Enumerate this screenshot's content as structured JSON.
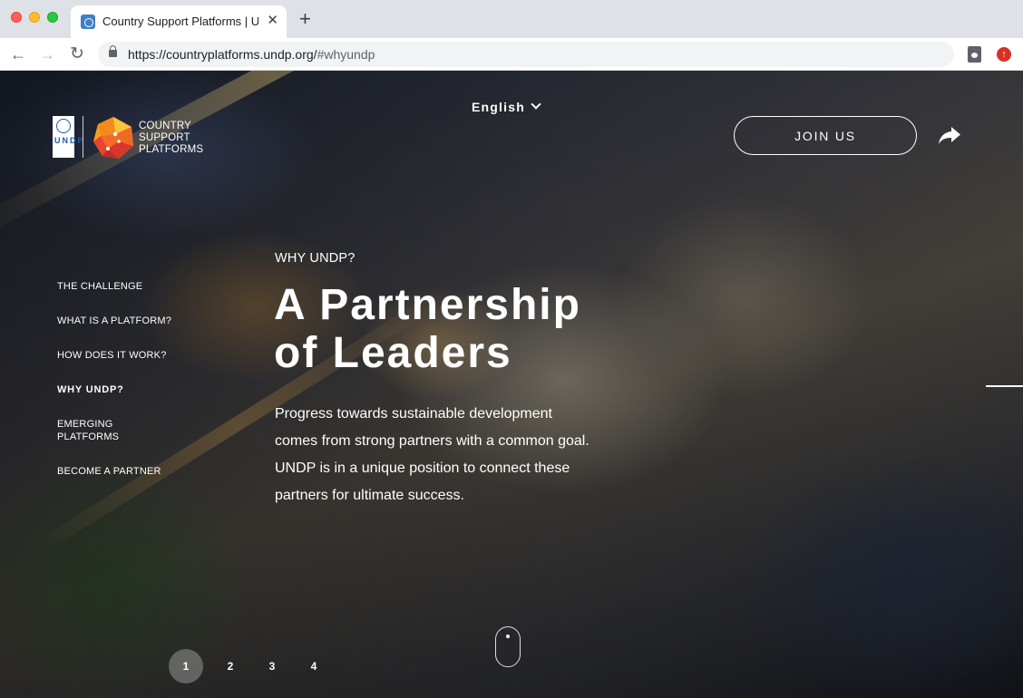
{
  "browser": {
    "tab_title": "Country Support Platforms | UNDP",
    "close_glyph": "✕",
    "new_tab_glyph": "+",
    "back_glyph": "←",
    "forward_glyph": "→",
    "reload_glyph": "↻",
    "url_main": "https://countryplatforms.undp.org/",
    "url_hash": "#whyundp",
    "update_glyph": "↑"
  },
  "logo": {
    "undp_letters": "UNDP",
    "line1": "COUNTRY",
    "line2": "SUPPORT",
    "line3": "PLATFORMS"
  },
  "header": {
    "language": "English",
    "join_label": "JOIN US"
  },
  "side_nav": {
    "items": [
      {
        "label": "THE CHALLENGE"
      },
      {
        "label": "WHAT IS A PLATFORM?"
      },
      {
        "label": "HOW DOES IT WORK?"
      },
      {
        "label": "WHY UNDP?"
      },
      {
        "label": "EMERGING PLATFORMS"
      },
      {
        "label": "BECOME A PARTNER"
      }
    ],
    "active_index": 3
  },
  "hero": {
    "eyebrow": "WHY UNDP?",
    "headline_line1": "A Partnership",
    "headline_line2": "of Leaders",
    "body": "Progress towards sustainable development comes from strong partners with a common goal. UNDP is in a unique position to connect these partners for ultimate success."
  },
  "pager": {
    "pages": [
      "1",
      "2",
      "3",
      "4"
    ],
    "active_page": "1"
  },
  "colors": {
    "undp_blue": "#1f5aa6",
    "text_on_hero": "#ffffff"
  }
}
